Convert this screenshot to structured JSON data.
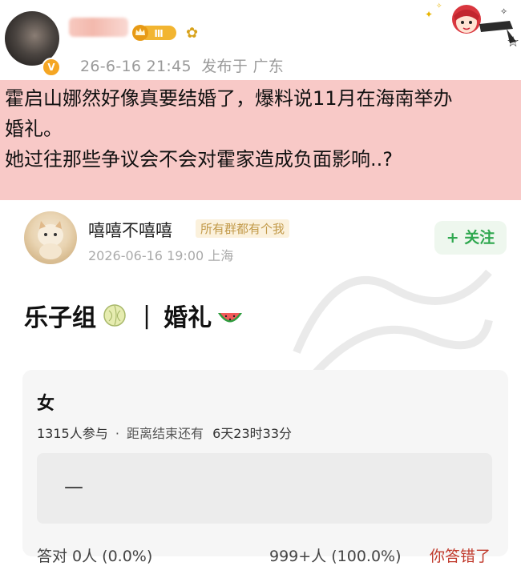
{
  "post": {
    "timestamp": "26-6-16 21:45",
    "location": "发布于 广东",
    "badge_level": "Ⅲ",
    "text_lines": [
      "霍启山娜然好像真要结婚了，爆料说11月在海南举办",
      "婚礼。",
      "她过往那些争议会不会对霍家造成负面影响..?"
    ],
    "highlight_color": "#f8c9c7"
  },
  "embedded": {
    "author": "嘻嘻不嘻嘻",
    "group_tag": "所有群都有个我",
    "meta": "2026-06-16 19:00 上海",
    "follow_label": "+ 关注",
    "poll_title_left": "乐子组",
    "poll_title_sep": "|",
    "poll_title_right": "婚礼",
    "poll": {
      "question": "女",
      "participants": "1315人参与",
      "dot": "·",
      "remaining_label": "距离结束还有",
      "remaining": "6天23时33分",
      "option_label": "—",
      "result_correct": "答对 0人 (0.0%)",
      "result_wrong": "999+人 (100.0%)",
      "your_answer": "你答错了"
    },
    "accent_green": "#2fa84f"
  },
  "icons": [
    "verified-icon",
    "crown-icon",
    "sunflower-icon",
    "anime-sticker",
    "melon-icon",
    "watermelon-icon"
  ]
}
